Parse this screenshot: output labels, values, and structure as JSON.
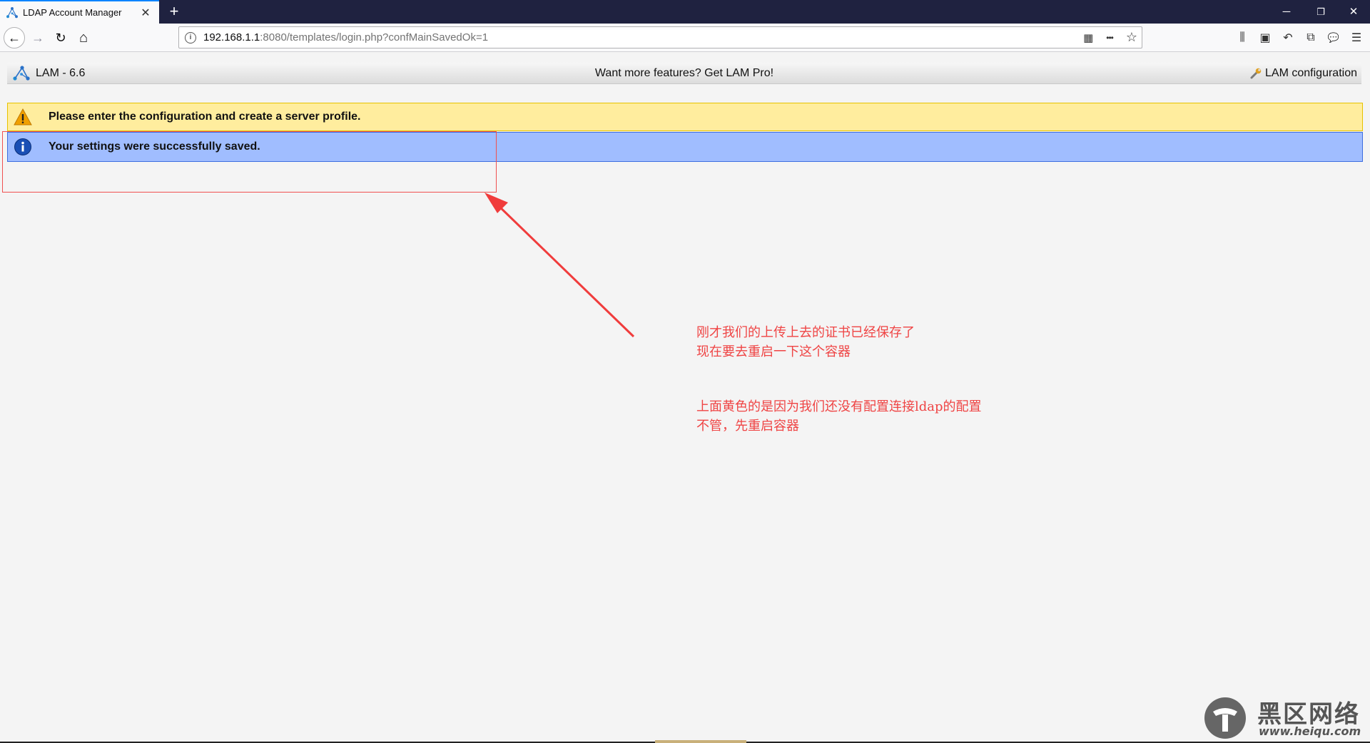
{
  "browser": {
    "tab_title": "LDAP Account Manager",
    "tab_close": "✕",
    "new_tab": "+",
    "window_controls": {
      "minimize": "─",
      "restore": "❐",
      "close": "✕"
    },
    "nav": {
      "back": "←",
      "forward": "→",
      "reload": "↻",
      "home": "⌂"
    },
    "url_host": "192.168.1.1",
    "url_rest": ":8080/templates/login.php?confMainSavedOk=1",
    "url_info": "i",
    "url_actions": {
      "qr": "▦",
      "more": "•••",
      "bookmark": "☆"
    },
    "toolbar": {
      "library": "⫼",
      "sidebar": "▣",
      "undo": "↶",
      "screenshot": "⧉",
      "chat": "💬",
      "menu": "☰"
    }
  },
  "lam": {
    "title": "LAM - 6.6",
    "promo": "Want more features? Get LAM Pro!",
    "config_link": "LAM configuration"
  },
  "messages": {
    "warning": "Please enter the configuration and create a server profile.",
    "info": "Your settings were successfully saved."
  },
  "annotation": {
    "note1_line1": "刚才我们的上传上去的证书已经保存了",
    "note1_line2": "现在要去重启一下这个容器",
    "note2_line1": "上面黄色的是因为我们还没有配置连接ldap的配置",
    "note2_line2": "不管，先重启容器"
  },
  "watermark": {
    "title": "黑区网络",
    "url": "www.heiqu.com"
  },
  "colors": {
    "tabbar": "#1f2240",
    "warning_bg": "#ffed9e",
    "info_bg": "#a0bdff",
    "annotation": "#ef4444"
  }
}
